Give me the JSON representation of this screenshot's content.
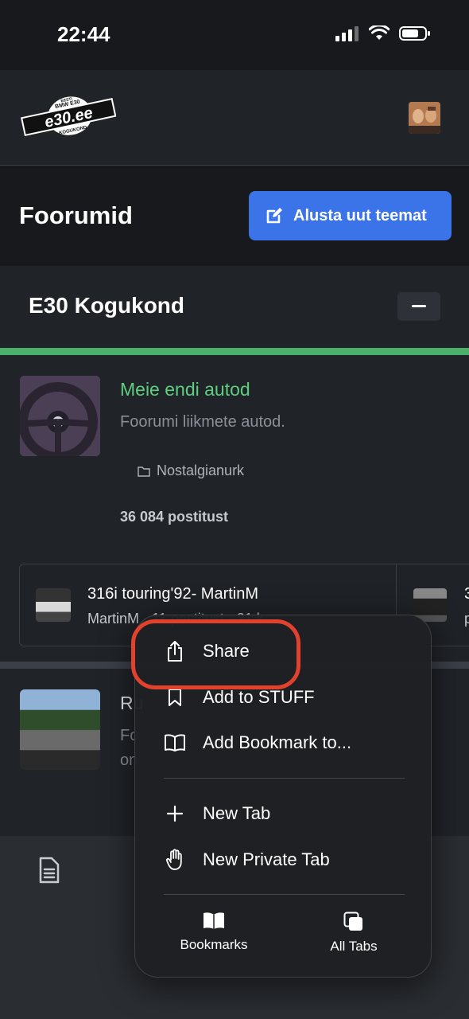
{
  "status_bar": {
    "time": "22:44"
  },
  "header": {
    "logo_top": "EESTI",
    "logo_sub": "BMW E30",
    "logo_main": "e30.ee",
    "logo_bottom": "KOGUKOND"
  },
  "title_bar": {
    "title": "Foorumid",
    "new_topic_label": "Alusta uut teemat"
  },
  "category": {
    "title": "E30 Kogukond"
  },
  "forum": {
    "name": "Meie endi autod",
    "description": "Foorumi liikmete autod.",
    "subforum": "Nostalgianurk",
    "post_count": "36 084 postitust",
    "latest": {
      "title": "316i touring'92- MartinM",
      "meta": "MartinM · 11 postitust · 21 k",
      "title2": "3",
      "meta2": "p"
    }
  },
  "forum2": {
    "name": "Ru",
    "desc_line1": "Fo",
    "desc_line2": "on"
  },
  "context_menu": {
    "items": [
      {
        "label": "Share",
        "icon": "share-icon"
      },
      {
        "label": "Add to STUFF",
        "icon": "bookmark-icon"
      },
      {
        "label": "Add Bookmark to...",
        "icon": "book-icon"
      },
      {
        "label": "New Tab",
        "icon": "plus-icon"
      },
      {
        "label": "New Private Tab",
        "icon": "hand-icon"
      }
    ],
    "bottom": [
      {
        "label": "Bookmarks",
        "icon": "bookmarks-icon"
      },
      {
        "label": "All Tabs",
        "icon": "tabs-icon"
      }
    ]
  },
  "highlight_color": "#e2412d",
  "accent_color": "#3a74e8",
  "forum_link_color": "#5fcf7f"
}
